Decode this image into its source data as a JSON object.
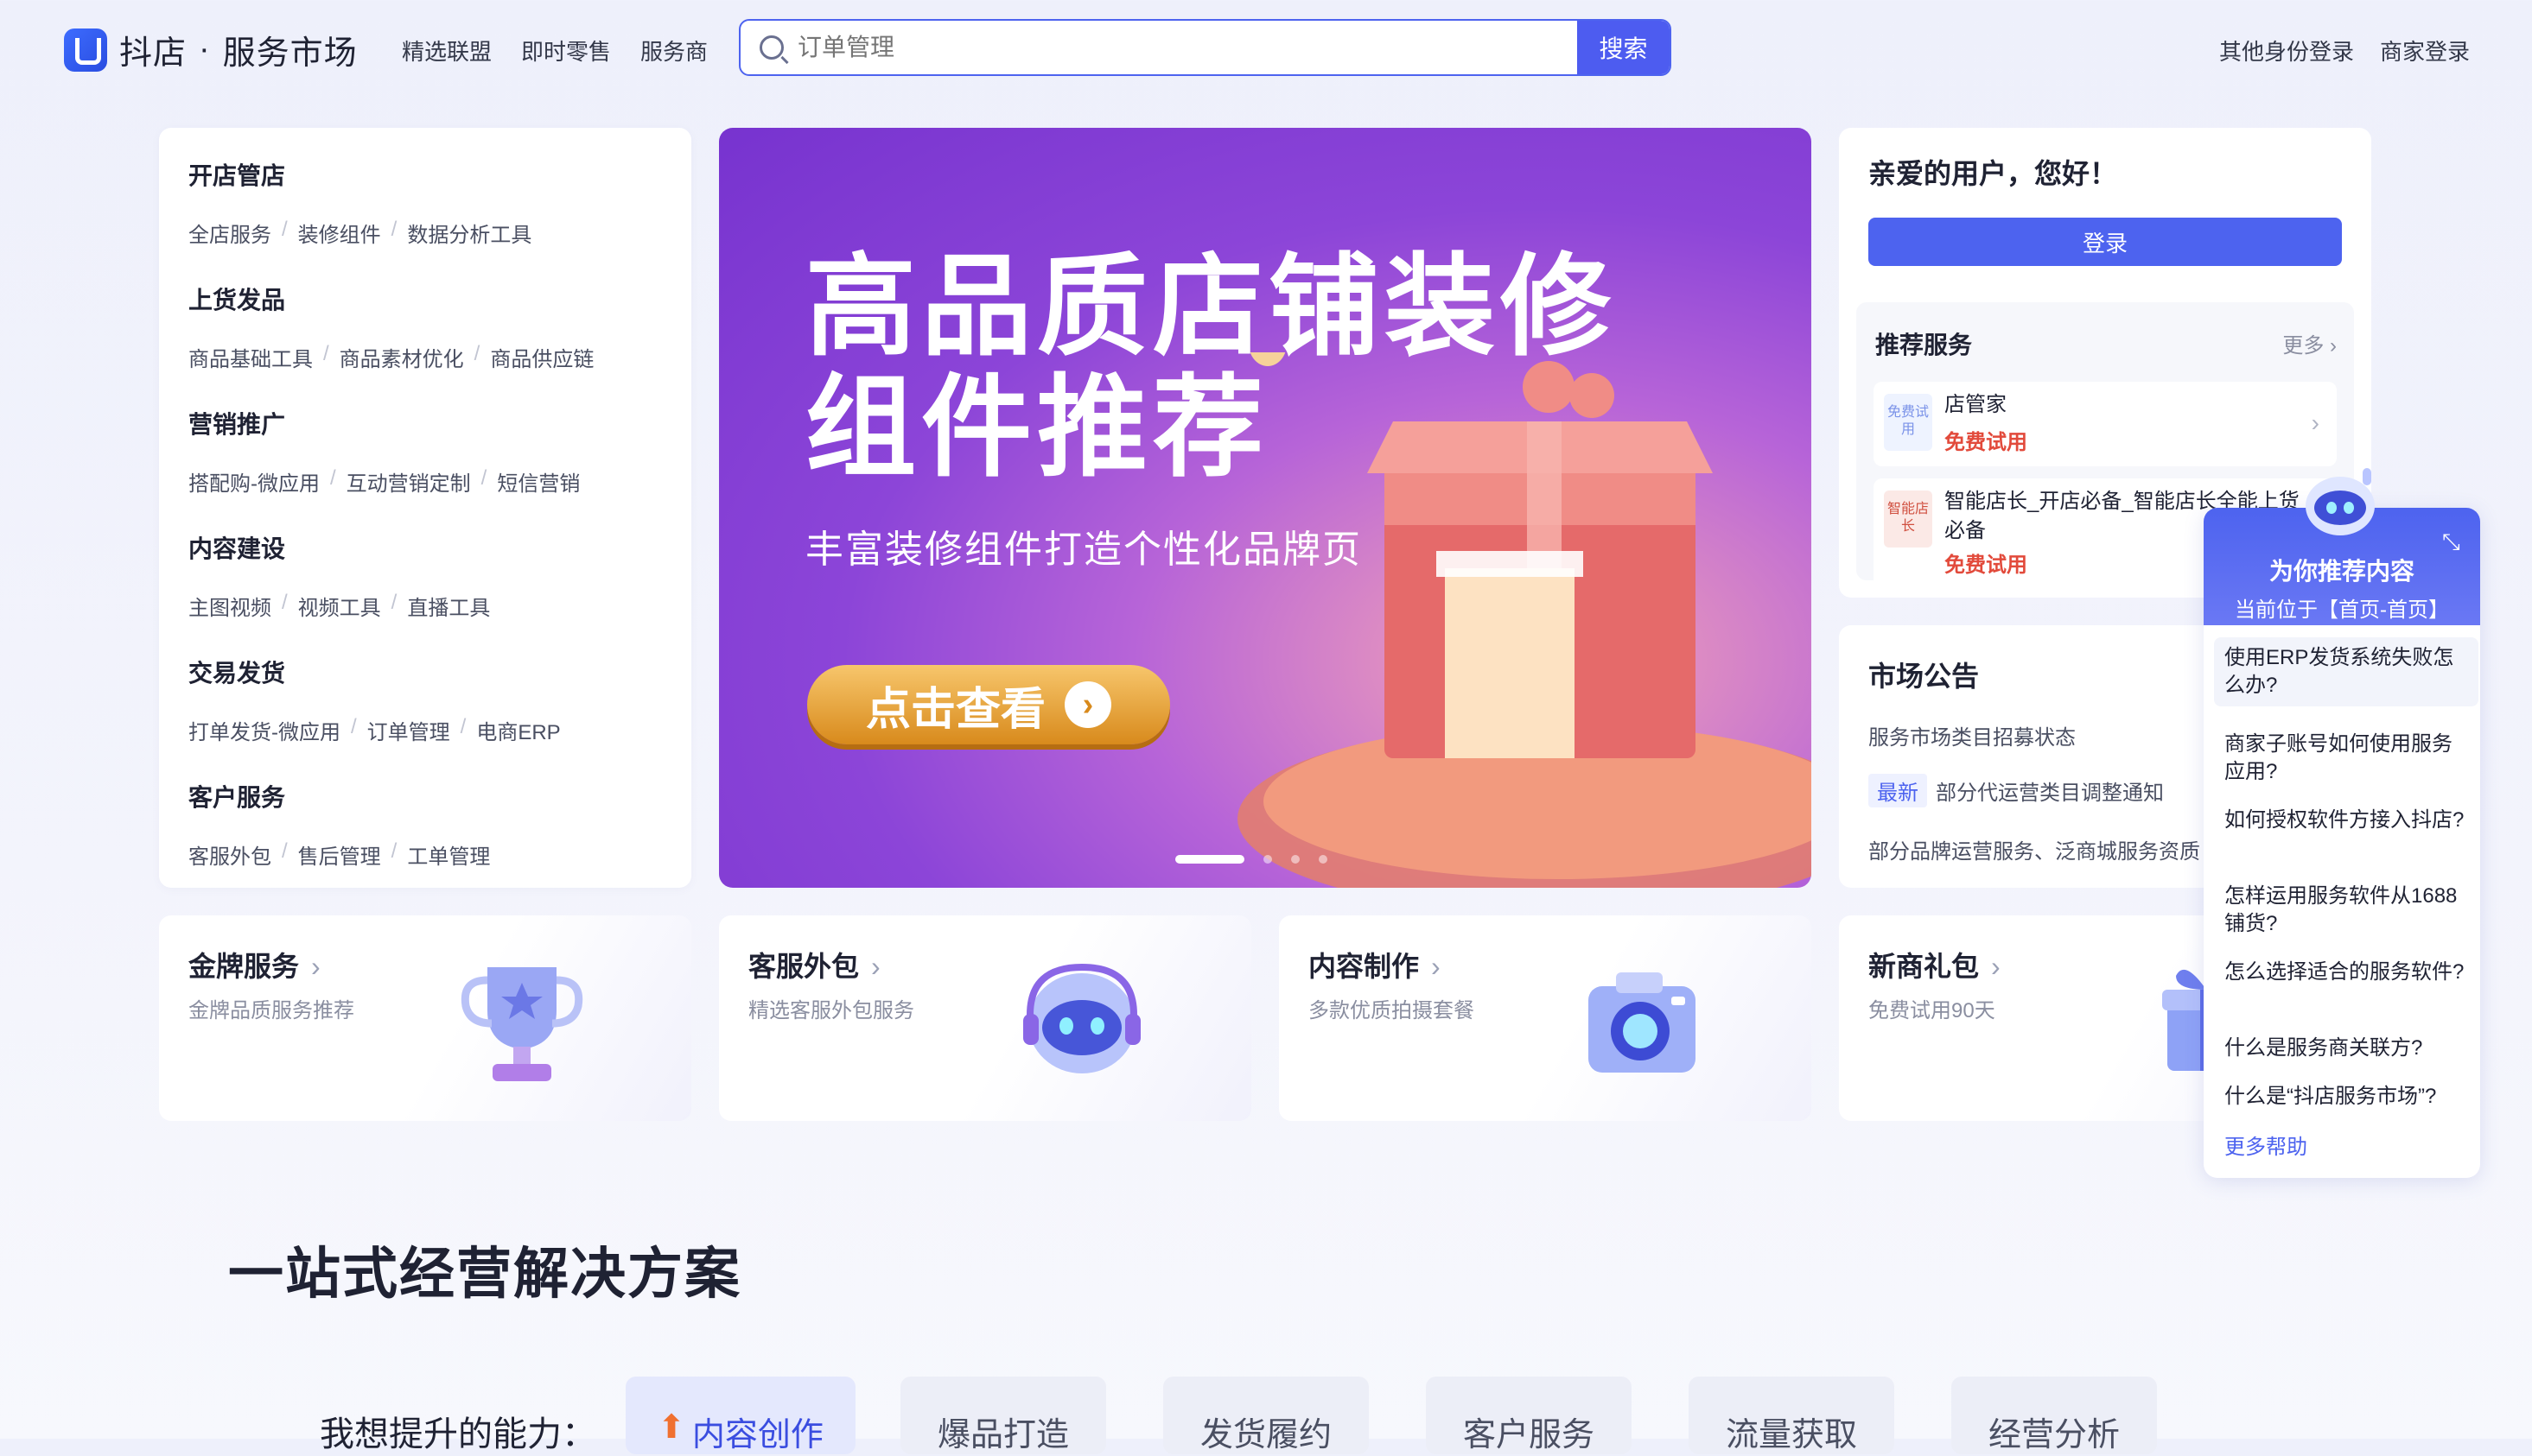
{
  "header": {
    "brand": "抖店",
    "brand_sep": "·",
    "brand_sub": "服务市场",
    "nav": [
      "精选联盟",
      "即时零售",
      "服务商"
    ],
    "search_placeholder": "订单管理",
    "search_button": "搜索",
    "links": [
      "其他身份登录",
      "商家登录"
    ]
  },
  "categories": [
    {
      "title": "开店管店",
      "links": [
        "全店服务",
        "装修组件",
        "数据分析工具"
      ]
    },
    {
      "title": "上货发品",
      "links": [
        "商品基础工具",
        "商品素材优化",
        "商品供应链"
      ]
    },
    {
      "title": "营销推广",
      "links": [
        "搭配购-微应用",
        "互动营销定制",
        "短信营销"
      ]
    },
    {
      "title": "内容建设",
      "links": [
        "主图视频",
        "视频工具",
        "直播工具"
      ]
    },
    {
      "title": "交易发货",
      "links": [
        "打单发货-微应用",
        "订单管理",
        "电商ERP"
      ]
    },
    {
      "title": "客户服务",
      "links": [
        "客服外包",
        "售后管理",
        "工单管理"
      ]
    }
  ],
  "banner": {
    "title_line1": "高品质店铺装修",
    "title_line2": "组件推荐",
    "subtitle": "丰富装修组件打造个性化品牌页",
    "cta": "点击查看",
    "slide_count": 4,
    "active_slide": 1
  },
  "user_panel": {
    "greeting": "亲爱的用户，您好！",
    "login": "登录",
    "recommend_title": "推荐服务",
    "recommend_more": "更多",
    "items": [
      {
        "thumb_text": "免费试用",
        "name": "店管家",
        "tag": "免费试用"
      },
      {
        "thumb_text": "智能店长",
        "name": "智能店长_开店必备_智能店长全能上货必备",
        "tag": "免费试用"
      }
    ]
  },
  "notice": {
    "title": "市场公告",
    "rows": [
      {
        "badge": "",
        "text": "服务市场类目招募状态"
      },
      {
        "badge": "最新",
        "text": "部分代运营类目调整通知"
      },
      {
        "badge": "",
        "text": "部分品牌运营服务、泛商城服务资质"
      }
    ]
  },
  "features": [
    {
      "title": "金牌服务",
      "subtitle": "金牌品质服务推荐",
      "icon": "trophy-icon"
    },
    {
      "title": "客服外包",
      "subtitle": "精选客服外包服务",
      "icon": "robot-headset-icon"
    },
    {
      "title": "内容制作",
      "subtitle": "多款优质拍摄套餐",
      "icon": "camera-icon"
    },
    {
      "title": "新商礼包",
      "subtitle": "免费试用90天",
      "icon": "gift-icon"
    }
  ],
  "solutions": {
    "title": "一站式经营解决方案",
    "ability_label": "我想提升的能力：",
    "tabs": [
      "内容创作",
      "爆品打造",
      "发货履约",
      "客户服务",
      "流量获取",
      "经营分析"
    ],
    "active_tab": 0
  },
  "helper": {
    "title": "为你推荐内容",
    "location": "当前位于【首页-首页】",
    "questions": [
      "使用ERP发货系统失败怎么办?",
      "商家子账号如何使用服务应用?",
      "如何授权软件方接入抖店?",
      "怎样运用服务软件从1688铺货?",
      "怎么选择适合的服务软件?",
      "什么是服务商关联方?",
      "什么是“抖店服务市场”?"
    ],
    "more": "更多帮助"
  },
  "colors": {
    "accent": "#4d63ef",
    "tag_red": "#e24a3b",
    "banner_purple": "#8c45d8",
    "cta_gold": "#e9a640"
  }
}
